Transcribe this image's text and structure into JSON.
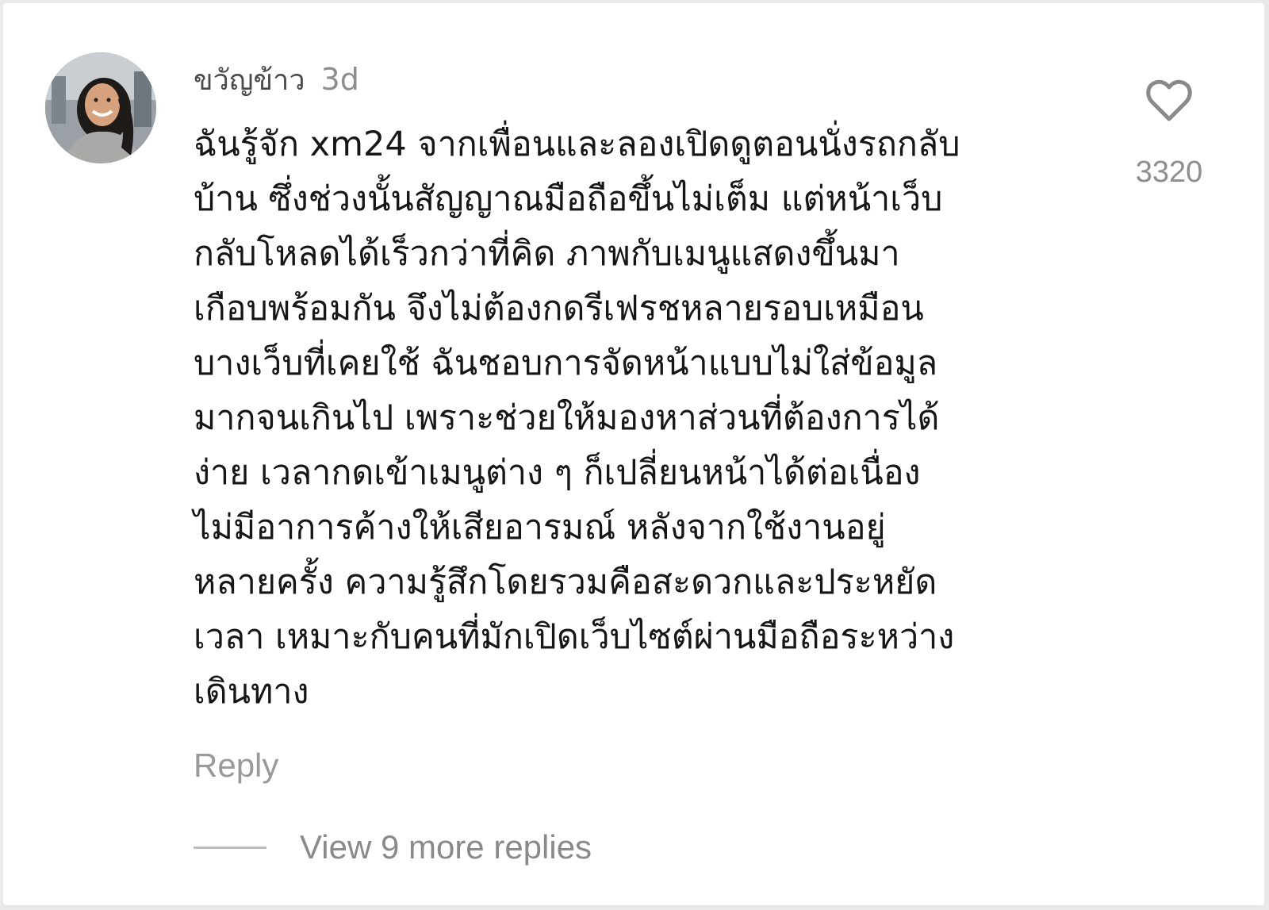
{
  "comment": {
    "username": "ขวัญข้าว",
    "timestamp": "3d",
    "text_lines": [
      "ฉันรู้จัก xm24 จากเพื่อนและลองเปิดดูตอนนั่งรถกลับ",
      "บ้าน ซึ่งช่วงนั้นสัญญาณมือถือขึ้นไม่เต็ม แต่หน้าเว็บ",
      "กลับโหลดได้เร็วกว่าที่คิด ภาพกับเมนูแสดงขึ้นมา",
      "เกือบพร้อมกัน จึงไม่ต้องกดรีเฟรชหลายรอบเหมือน",
      "บางเว็บที่เคยใช้ ฉันชอบการจัดหน้าแบบไม่ใส่ข้อมูล",
      "มากจนเกินไป เพราะช่วยให้มองหาส่วนที่ต้องการได้",
      "ง่าย เวลากดเข้าเมนูต่าง ๆ ก็เปลี่ยนหน้าได้ต่อเนื่อง",
      "ไม่มีอาการค้างให้เสียอารมณ์ หลังจากใช้งานอยู่",
      "หลายครั้ง ความรู้สึกโดยรวมคือสะดวกและประหยัด",
      "เวลา เหมาะกับคนที่มักเปิดเว็บไซต์ผ่านมือถือระหว่าง",
      "เดินทาง"
    ],
    "like_count": "3320",
    "reply_label": "Reply",
    "view_replies_label": "View 9 more replies",
    "icons": {
      "like": "heart-outline-icon",
      "avatar": "user-avatar-photo"
    }
  },
  "colors": {
    "background": "#ffffff",
    "text": "#161616",
    "muted": "#8e8e8e"
  }
}
